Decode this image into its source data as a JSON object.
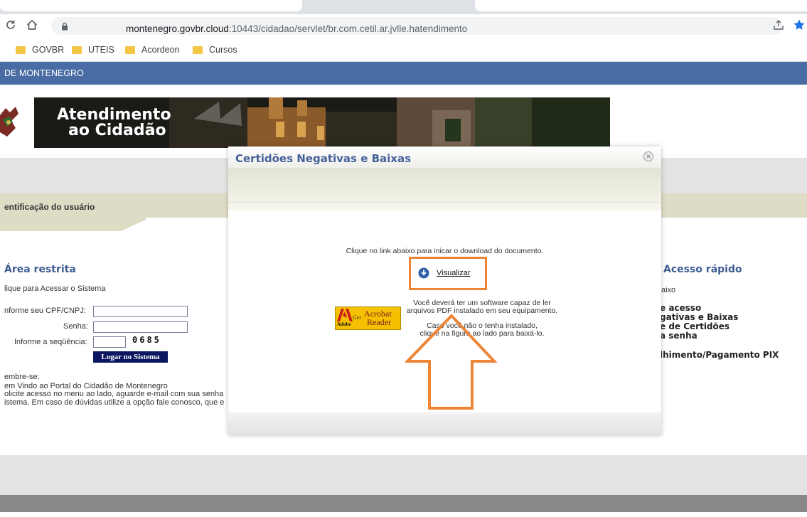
{
  "browser": {
    "url_host": "montenegro.govbr.cloud",
    "url_path": ":10443/cidadao/servlet/br.com.cetil.ar.jvlle.hatendimento",
    "bookmarks": [
      "GOVBR",
      "UTEIS",
      "Acordeon",
      "Cursos"
    ]
  },
  "site": {
    "header": "DE MONTENEGRO",
    "banner_line1": "Atendimento",
    "banner_line2": "ao Cidadão",
    "ident_title": "entificação do usuário",
    "area_title": "Área restrita",
    "area_sub": "lique para Acessar o Sistema",
    "cpf_label": "nforme seu CPF/CNPJ:",
    "senha_label": "Senha:",
    "seq_label": "Informe a seqüência:",
    "captcha": "0685",
    "login_button": "Logar no Sistema",
    "lembre_title": "embre-se:",
    "lembre_lines": [
      "em Vindo ao Portal do Cidadão de Montenegro",
      "olicite acesso no menu ao lado, aguarde e-mail com sua senha",
      "istema. Em caso de dúvidas utilize a opção fale conosco, que e"
    ],
    "quick_title": "Acesso rápido",
    "quick_sub": "aixo",
    "quick_items": [
      "e acesso",
      "gativas e Baixas",
      "e de Certidões",
      "a senha",
      "lhimento/Pagamento PIX"
    ]
  },
  "modal": {
    "title": "Certidões Negativas e Baixas",
    "instruction": "Clique no link abaixo para inicar o download do documento.",
    "link_label": "Visualizar",
    "software_line1": "Você deverá ter um software capaz de ler",
    "software_line2": "arquivos PDF instalado em seu equipamento.",
    "install_line1": "Caso você não o tenha instalado,",
    "install_line2": "clique na figura ao lado para baixá-lo.",
    "acrobat": {
      "adobe": "Adobe",
      "get": "Get",
      "line1": "Acrobat",
      "line2": "Reader"
    }
  },
  "colors": {
    "site_header": "#4a6ca5",
    "login_button": "#0b1560",
    "highlight": "#ee8436",
    "modal_title": "#45609a"
  }
}
